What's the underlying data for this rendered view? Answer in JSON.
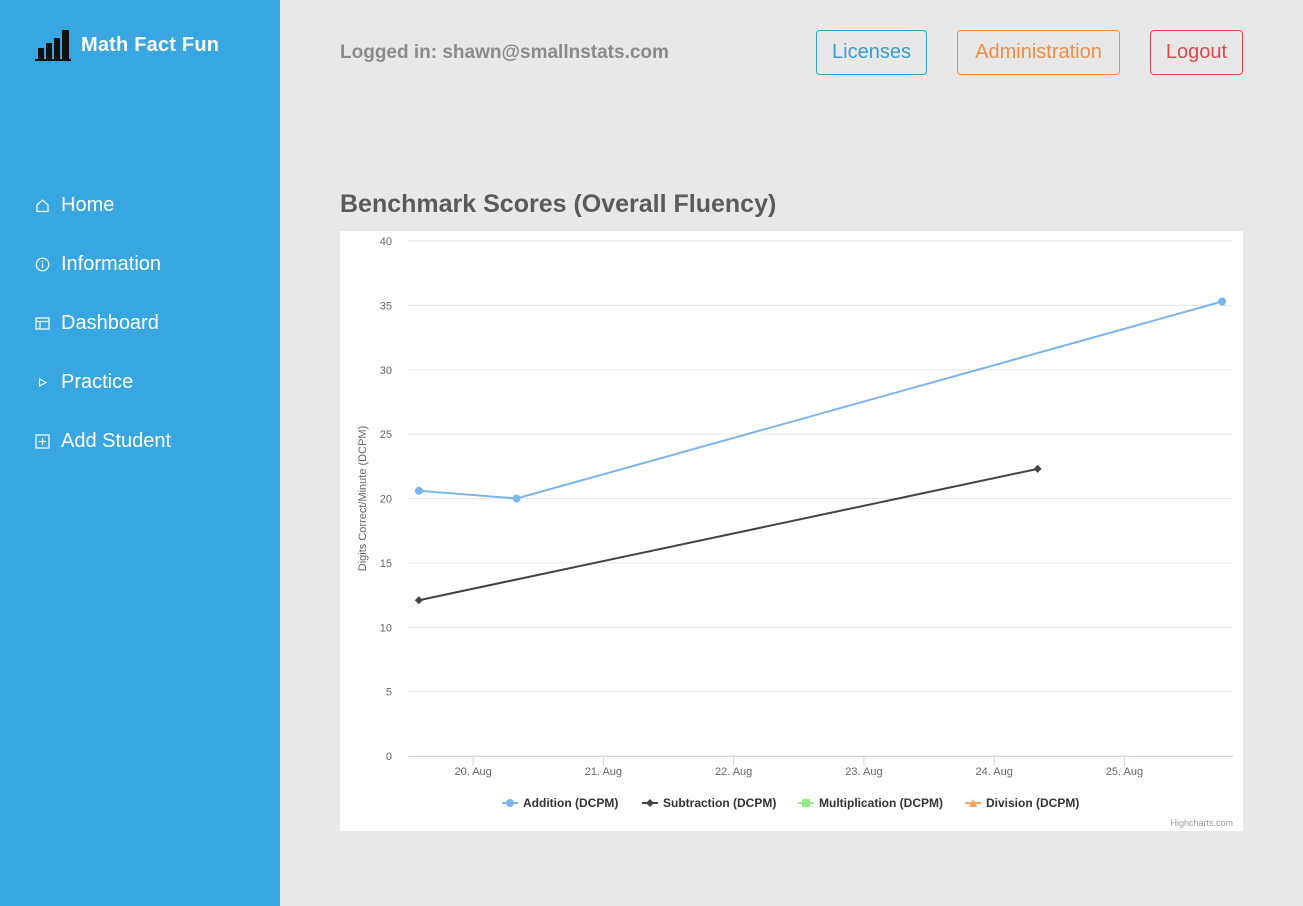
{
  "app": {
    "name": "Math Fact Fun",
    "logo_icon": "bar-chart-icon"
  },
  "sidebar": {
    "items": [
      {
        "label": "Home",
        "icon": "home-icon"
      },
      {
        "label": "Information",
        "icon": "info-icon"
      },
      {
        "label": "Dashboard",
        "icon": "dashboard-icon"
      },
      {
        "label": "Practice",
        "icon": "play-icon"
      },
      {
        "label": "Add Student",
        "icon": "add-box-icon"
      }
    ]
  },
  "header": {
    "logged_in": "Logged in: shawn@smallnstats.com",
    "licenses_label": "Licenses",
    "administration_label": "Administration",
    "logout_label": "Logout"
  },
  "main": {
    "title": "Benchmark Scores (Overall Fluency)"
  },
  "colors": {
    "sidebar": "#38a7e1",
    "addition": "#7cb5ec",
    "subtraction": "#434348",
    "multiplication": "#90ed7d",
    "division": "#f7a35c"
  },
  "chart_data": {
    "type": "line",
    "title": "",
    "xlabel": "",
    "ylabel": "Digits Correct/Minute (DCPM)",
    "ylim": [
      0,
      40
    ],
    "xlim": [
      "2020-08-19T12:00",
      "2020-08-25T20:00"
    ],
    "y_ticks": [
      "0",
      "5",
      "10",
      "15",
      "20",
      "25",
      "30",
      "35",
      "40"
    ],
    "x_ticks": [
      "20. Aug",
      "21. Aug",
      "22. Aug",
      "23. Aug",
      "24. Aug",
      "25. Aug"
    ],
    "grid": true,
    "legend_position": "bottom-center",
    "credits": "Highcharts.com",
    "series": [
      {
        "name": "Addition (DCPM)",
        "marker": "circle",
        "points": [
          {
            "x": "2020-08-19T14:00",
            "y": 20.6
          },
          {
            "x": "2020-08-20T08:00",
            "y": 20.0
          },
          {
            "x": "2020-08-25T18:00",
            "y": 35.3
          }
        ]
      },
      {
        "name": "Subtraction (DCPM)",
        "marker": "diamond",
        "points": [
          {
            "x": "2020-08-19T14:00",
            "y": 12.1
          },
          {
            "x": "2020-08-24T08:00",
            "y": 22.3
          }
        ]
      },
      {
        "name": "Multiplication (DCPM)",
        "marker": "square",
        "points": []
      },
      {
        "name": "Division (DCPM)",
        "marker": "triangle",
        "points": []
      }
    ]
  }
}
